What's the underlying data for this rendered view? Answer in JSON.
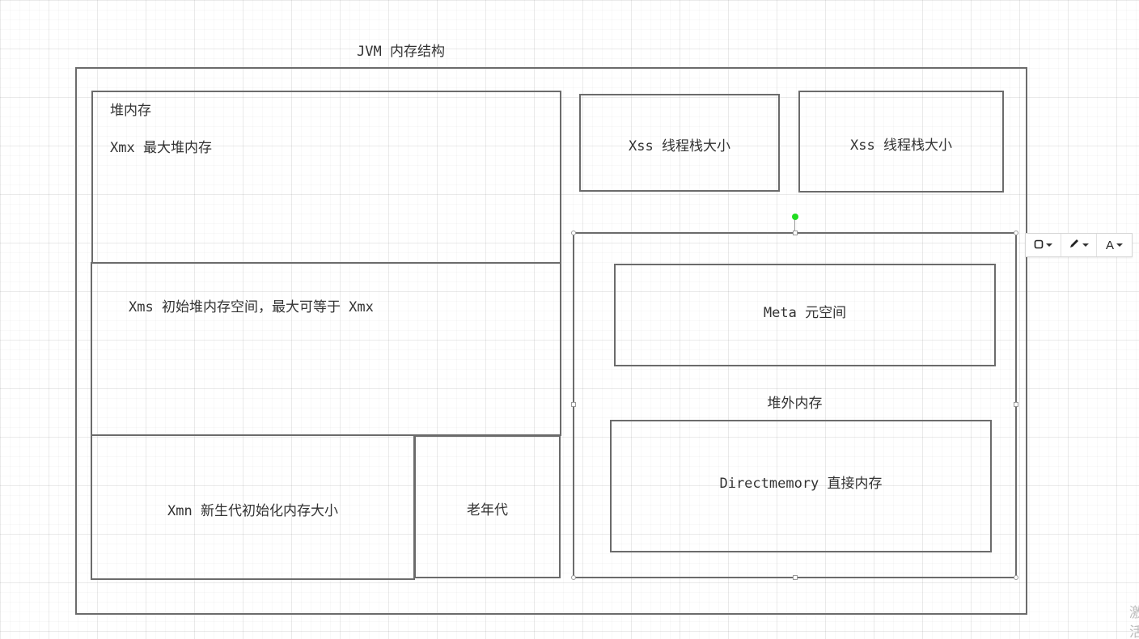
{
  "diagram": {
    "title": "JVM 内存结构",
    "heap": {
      "title": "堆内存",
      "xmx_label": "Xmx 最大堆内存",
      "xms_label": "Xms 初始堆内存空间，最大可等于 Xmx",
      "xmn_label": "Xmn 新生代初始化内存大小",
      "old_gen_label": "老年代"
    },
    "stacks": [
      {
        "label": "Xss 线程栈大小"
      },
      {
        "label": "Xss 线程栈大小"
      }
    ],
    "offheap": {
      "title": "堆外内存",
      "meta_label": "Meta 元空间",
      "direct_label": "Directmemory 直接内存"
    }
  },
  "toolbar": {
    "shape_icon": "rounded-square-icon",
    "pen_icon": "pencil-icon",
    "text_label": "A"
  },
  "watermark": {
    "text": "激活"
  },
  "colors": {
    "box_border": "#6b6b6b",
    "selection_handle": "#9a9a9a",
    "rotate_handle": "#22dd22",
    "text": "#333333"
  }
}
